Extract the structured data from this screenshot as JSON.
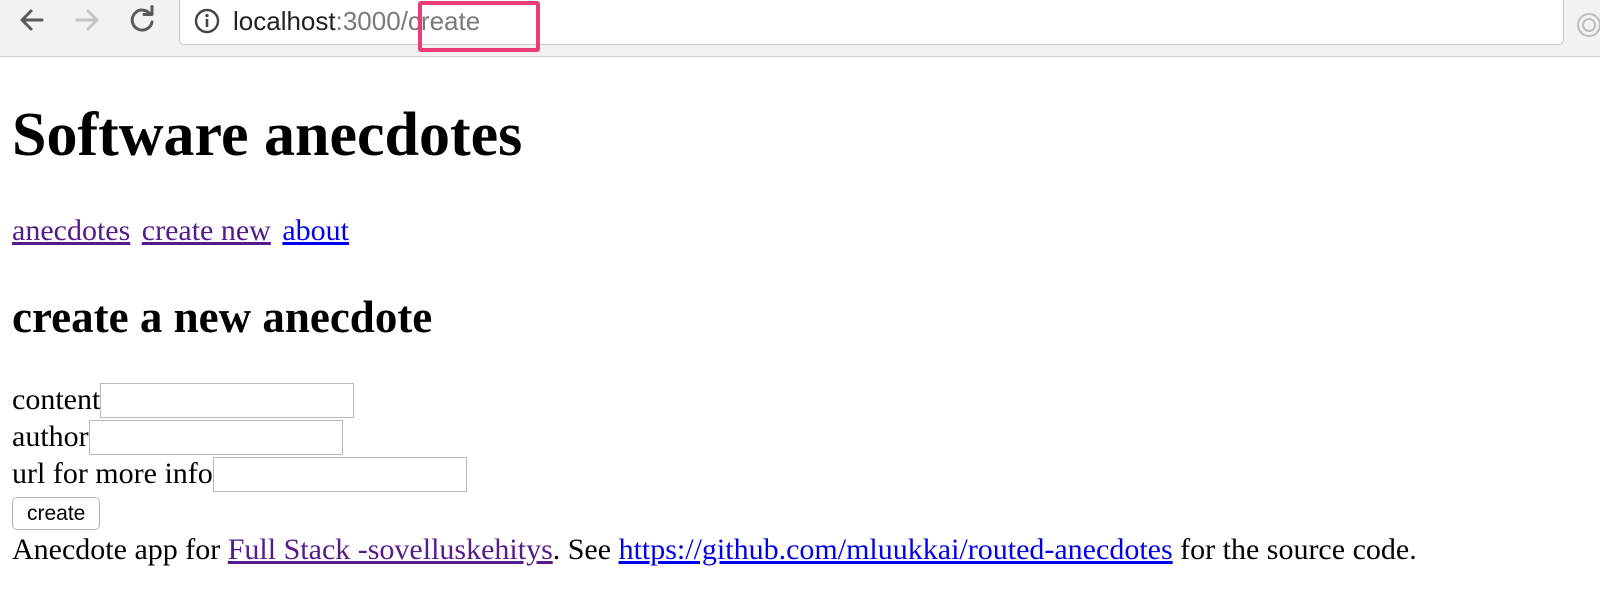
{
  "browser": {
    "url_host": "localhost",
    "url_port": ":3000",
    "url_path": "/create",
    "icons": [
      "back-arrow-icon",
      "forward-arrow-icon",
      "reload-icon",
      "info-icon"
    ]
  },
  "page": {
    "title": "Software anecdotes",
    "menu": [
      {
        "label": "anecdotes"
      },
      {
        "label": "create new"
      },
      {
        "label": "about"
      }
    ],
    "form": {
      "heading": "create a new anecdote",
      "fields": [
        {
          "label": "content",
          "value": ""
        },
        {
          "label": "author",
          "value": ""
        },
        {
          "label": "url for more info",
          "value": ""
        }
      ],
      "submit_label": "create"
    },
    "footer": {
      "prefix": "Anecdote app for ",
      "course_link": "Full Stack -sovelluskehitys",
      "middle": ". See ",
      "repo_link": "https://github.com/mluukkai/routed-anecdotes",
      "suffix": " for the source code."
    }
  },
  "colors": {
    "visited_link": "#551a8b",
    "unvisited_link": "#0000ee",
    "highlight_box": "#ea3c76"
  }
}
